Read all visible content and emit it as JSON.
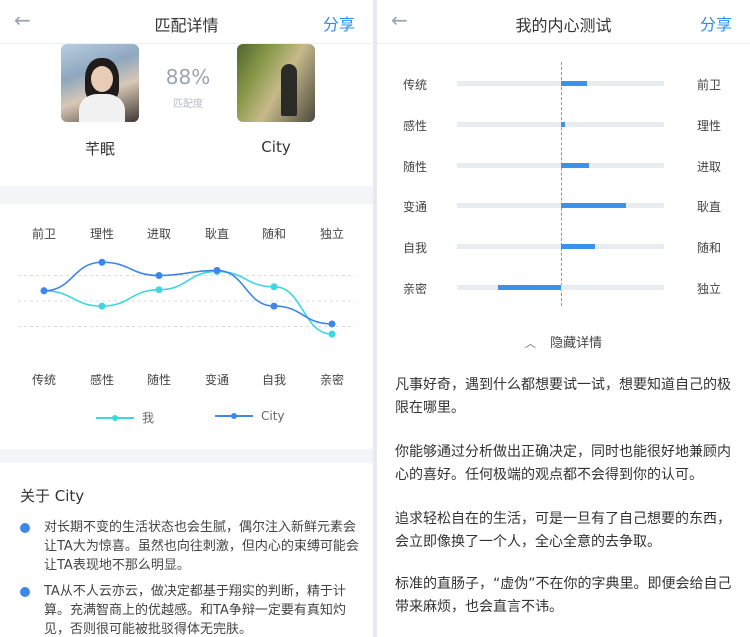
{
  "left_panel": {
    "nav": {
      "back_icon": "back-arrow-icon",
      "title": "匹配详情",
      "share": "分享"
    },
    "match": {
      "percent": "88%",
      "percent_label": "匹配度",
      "user_a": {
        "name": "芊眠"
      },
      "user_b": {
        "name": "City"
      }
    },
    "top_traits": [
      "前卫",
      "理性",
      "进取",
      "耿直",
      "随和",
      "独立"
    ],
    "bottom_traits": [
      "传统",
      "感性",
      "随性",
      "变通",
      "自我",
      "亲密"
    ],
    "legend": {
      "me": "我",
      "city": "City"
    },
    "about": {
      "title": "关于 City",
      "bullets": [
        "对长期不变的生活状态也会生腻，偶尔注入新鲜元素会让TA大为惊喜。虽然也向往刺激，但内心的束缚可能会让TA表现地不那么明显。",
        "TA从不人云亦云，做决定都基于翔实的判断，精于计算。充满智商上的优越感。和TA争辩一定要有真知灼见，否则很可能被批驳得体无完肤。"
      ]
    }
  },
  "right_panel": {
    "nav": {
      "back_icon": "back-arrow-icon",
      "title": "我的内心测试",
      "share": "分享"
    },
    "tests": [
      {
        "left": "传统",
        "right": "前卫",
        "value": 0.25
      },
      {
        "left": "感性",
        "right": "理性",
        "value": 0.04
      },
      {
        "left": "随性",
        "right": "进取",
        "value": 0.27
      },
      {
        "left": "变通",
        "right": "耿直",
        "value": 0.63
      },
      {
        "left": "自我",
        "right": "随和",
        "value": 0.33
      },
      {
        "left": "亲密",
        "right": "独立",
        "value": -0.61
      }
    ],
    "hide_details": "隐藏详情",
    "paragraphs": [
      "凡事好奇，遇到什么都想要试一试，想要知道自己的极限在哪里。",
      "你能够通过分析做出正确决定，同时也能很好地兼顾内心的喜好。任何极端的观点都不会得到你的认可。",
      "追求轻松自在的生活，可是一旦有了自己想要的东西，会立即像换了一个人，全心全意的去争取。",
      "标准的直肠子，“虚伪”不在你的字典里。即便会给自己带来麻烦，也会直言不讳。"
    ]
  },
  "chart_data": {
    "type": "line",
    "categories": [
      "传统/前卫",
      "感性/理性",
      "随性/进取",
      "变通/耿直",
      "自我/随和",
      "亲密/独立"
    ],
    "ylim": [
      -1,
      1
    ],
    "series": [
      {
        "name": "我",
        "color": "#3fd6e0",
        "values": [
          0.2,
          -0.1,
          0.22,
          0.58,
          0.28,
          -0.65
        ]
      },
      {
        "name": "City",
        "color": "#3f86e6",
        "values": [
          0.2,
          0.76,
          0.5,
          0.6,
          -0.1,
          -0.45
        ]
      }
    ]
  }
}
